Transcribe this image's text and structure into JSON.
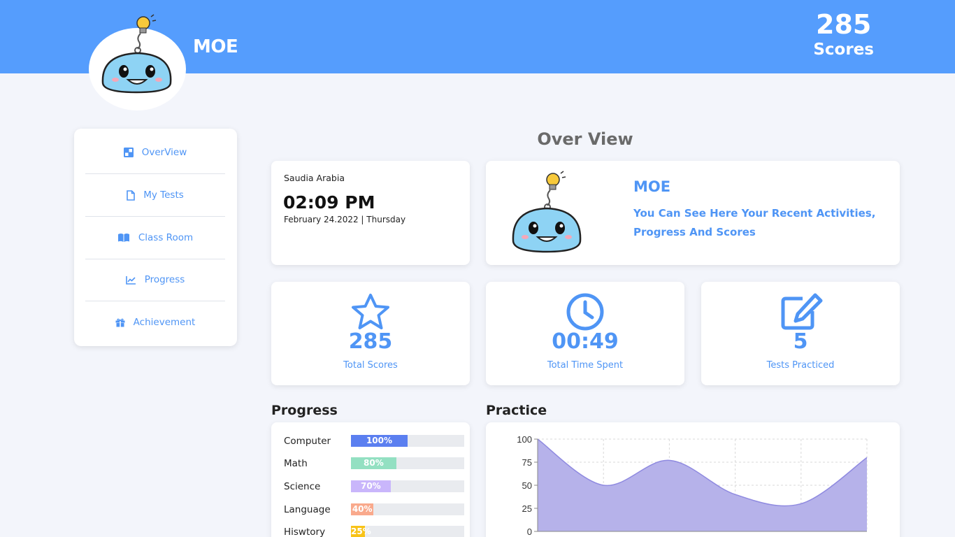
{
  "header": {
    "brand": "MOE",
    "score_value": "285",
    "score_label": "Scores"
  },
  "sidebar": {
    "items": [
      {
        "label": "OverView",
        "icon": "overview-icon"
      },
      {
        "label": "My Tests",
        "icon": "file-icon"
      },
      {
        "label": "Class Room",
        "icon": "book-icon"
      },
      {
        "label": "Progress",
        "icon": "chart-line-icon"
      },
      {
        "label": "Achievement",
        "icon": "gift-icon"
      }
    ]
  },
  "main": {
    "title": "Over View",
    "clock": {
      "country": "Saudia Arabia",
      "time": "02:09 PM",
      "date": "February 24.2022 | Thursday"
    },
    "welcome": {
      "title": "MOE",
      "text": "You Can See Here Your Recent Activities, Progress And Scores"
    },
    "stats": [
      {
        "value": "285",
        "label": "Total Scores",
        "icon": "star-icon"
      },
      {
        "value": "00:49",
        "label": "Total Time Spent",
        "icon": "clock-icon"
      },
      {
        "value": "5",
        "label": "Tests Practiced",
        "icon": "edit-icon"
      }
    ],
    "progress": {
      "title": "Progress",
      "items": [
        {
          "label": "Computer",
          "value": 100,
          "text": "100%",
          "color": "#5b7ff0"
        },
        {
          "label": "Math",
          "value": 80,
          "text": "80%",
          "color": "#93e0c2"
        },
        {
          "label": "Science",
          "value": 70,
          "text": "70%",
          "color": "#c9b6fb"
        },
        {
          "label": "Language",
          "value": 40,
          "text": "40%",
          "color": "#f9a98c"
        },
        {
          "label": "Hiswtory",
          "value": 25,
          "text": "25%",
          "color": "#f8c318"
        }
      ]
    },
    "practice": {
      "title": "Practice"
    }
  },
  "colors": {
    "accent": "#4f95f5",
    "header_bg": "#559dfd",
    "page_bg": "#f3f5fb",
    "chart_fill": "#b6b2ea",
    "chart_line": "#8f8ae0"
  },
  "chart_data": {
    "type": "area",
    "title": "",
    "xlabel": "",
    "ylabel": "",
    "ylim": [
      0,
      100
    ],
    "yticks": [
      0,
      25,
      50,
      75,
      100
    ],
    "grid": true,
    "series": [
      {
        "values": [
          100,
          50,
          77,
          40,
          30,
          80
        ]
      }
    ]
  }
}
